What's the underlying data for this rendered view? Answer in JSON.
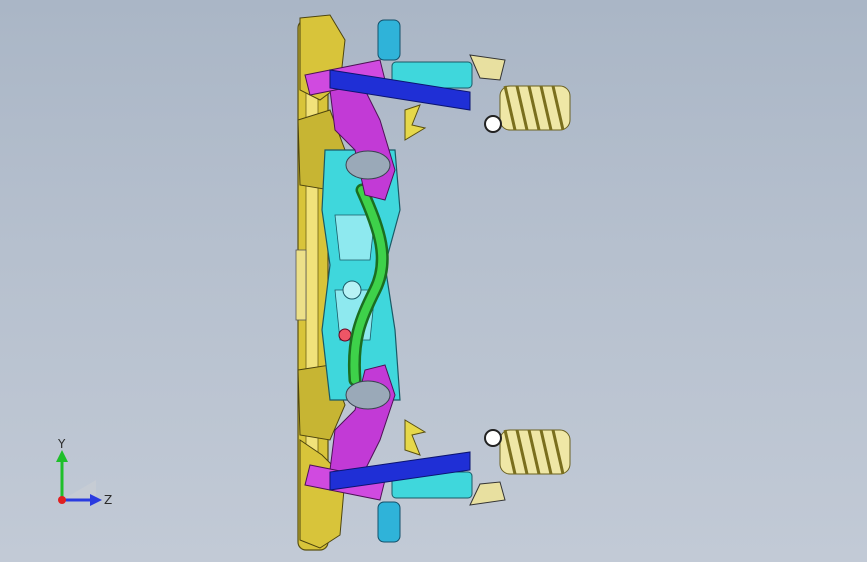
{
  "viewport": {
    "background_top": "#aab6c6",
    "background_bottom": "#c2cad6",
    "model": "front-suspension-subframe-assembly"
  },
  "triad": {
    "y_label": "Y",
    "z_label": "Z",
    "y_color": "#1fbf2a",
    "z_color": "#2a3be0",
    "x_color": "#e02020"
  },
  "colors": {
    "yellow": "#d8c43a",
    "dark_yellow": "#9c8a1e",
    "blue": "#1f2fd6",
    "cyan": "#3fd7dc",
    "magenta": "#c23ad6",
    "green": "#2fb63a",
    "spring": "#e0d870",
    "steel": "#8a99a8"
  }
}
